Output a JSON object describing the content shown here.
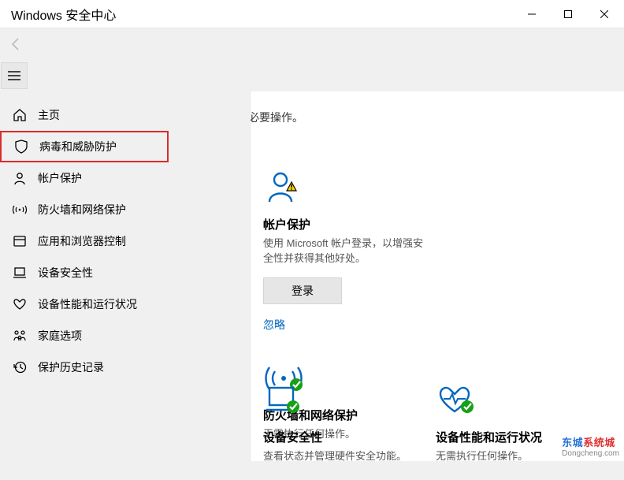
{
  "window": {
    "title": "Windows 安全中心"
  },
  "subtitle": "必要操作。",
  "nav": {
    "home": "主页",
    "virus": "病毒和威胁防护",
    "account": "帐户保护",
    "firewall": "防火墙和网络保护",
    "app": "应用和浏览器控制",
    "device_security": "设备安全性",
    "device_perf": "设备性能和运行状况",
    "family": "家庭选项",
    "history": "保护历史记录"
  },
  "cards": {
    "account": {
      "title": "帐户保护",
      "desc": "使用 Microsoft 帐户登录，以增强安全性并获得其他好处。",
      "button": "登录",
      "dismiss": "忽略"
    },
    "firewall": {
      "title": "防火墙和网络保护",
      "desc": "无需执行任何操作。"
    },
    "devsec": {
      "title": "设备安全性",
      "desc": "查看状态并管理硬件安全功能。"
    },
    "devperf": {
      "title": "设备性能和运行状况",
      "desc": "无需执行任何操作。"
    }
  },
  "watermark": {
    "brand1": "东城",
    "brand2": "系统城",
    "url": "Dongcheng.com"
  }
}
